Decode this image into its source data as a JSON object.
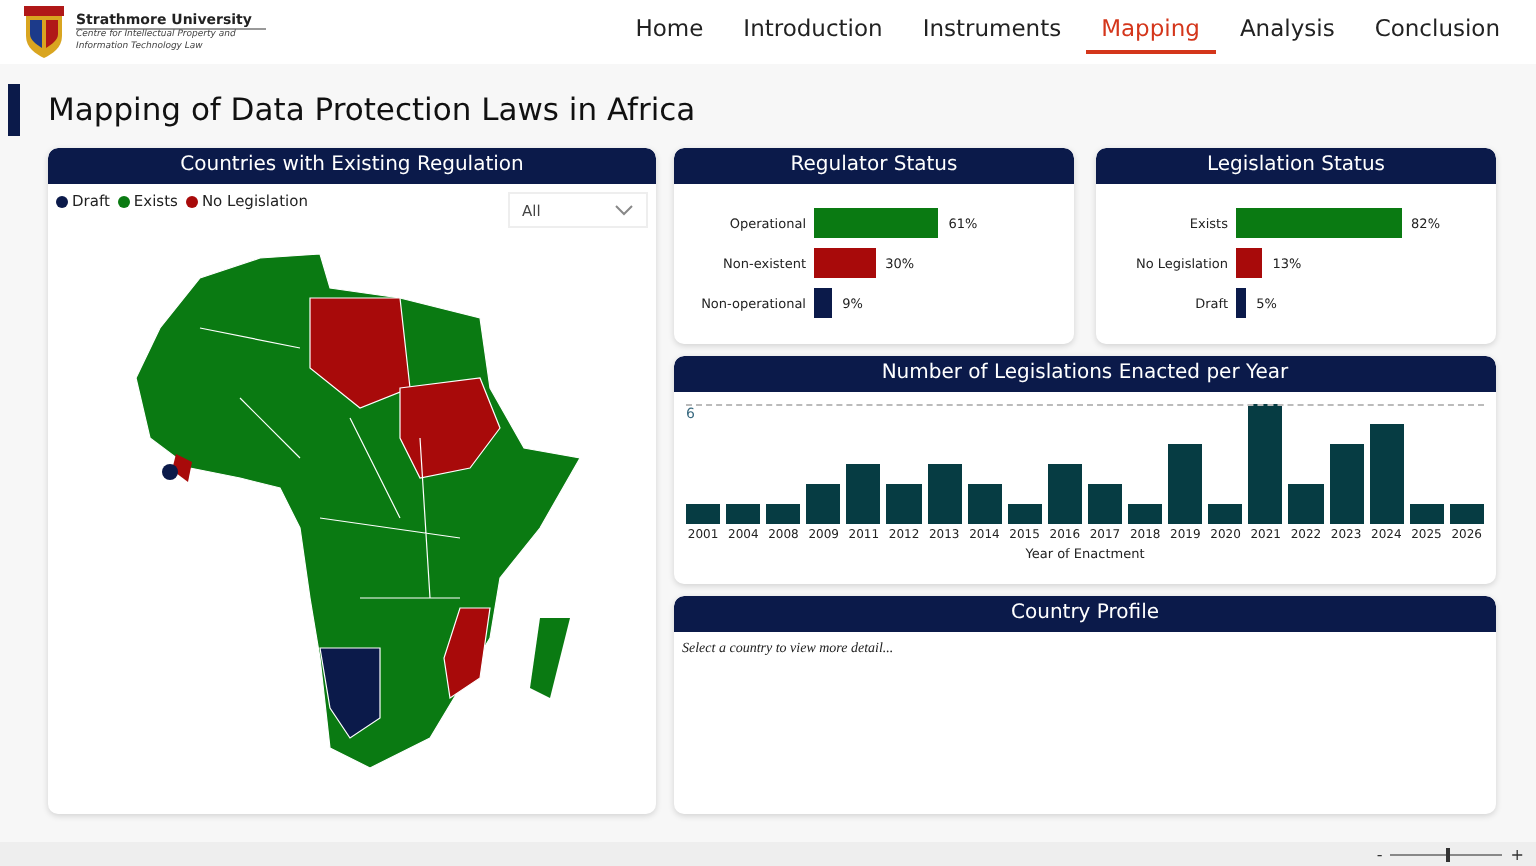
{
  "header": {
    "org_name": "Strathmore University",
    "org_subtitle": "Centre for Intellectual Property and Information Technology Law"
  },
  "nav": [
    {
      "label": "Home",
      "selected": false
    },
    {
      "label": "Introduction",
      "selected": false
    },
    {
      "label": "Instruments",
      "selected": false
    },
    {
      "label": "Mapping",
      "selected": true
    },
    {
      "label": "Analysis",
      "selected": false
    },
    {
      "label": "Conclusion",
      "selected": false
    }
  ],
  "page_title": "Mapping of Data Protection Laws in Africa",
  "map_card": {
    "title": "Countries with Existing Regulation",
    "legend": [
      {
        "label": "Draft",
        "color": "#0b1a4a"
      },
      {
        "label": "Exists",
        "color": "#0a7a12"
      },
      {
        "label": "No Legislation",
        "color": "#a80a0a"
      }
    ],
    "filter": {
      "value": "All"
    }
  },
  "regulator_card": {
    "title": "Regulator Status",
    "chart_data": {
      "type": "bar",
      "orientation": "horizontal",
      "categories": [
        "Operational",
        "Non-existent",
        "Non-operational"
      ],
      "values": [
        61,
        30,
        9
      ],
      "colors": [
        "#0a7a12",
        "#a80a0a",
        "#0b1a4a"
      ],
      "value_labels": [
        "61%",
        "30%",
        "9%"
      ]
    }
  },
  "legislation_card": {
    "title": "Legislation Status",
    "chart_data": {
      "type": "bar",
      "orientation": "horizontal",
      "categories": [
        "Exists",
        "No Legislation",
        "Draft"
      ],
      "values": [
        82,
        13,
        5
      ],
      "colors": [
        "#0a7a12",
        "#a80a0a",
        "#0b1a4a"
      ],
      "value_labels": [
        "82%",
        "13%",
        "5%"
      ]
    }
  },
  "years_card": {
    "title": "Number of Legislations Enacted per Year",
    "chart_data": {
      "type": "bar",
      "xlabel": "Year of Enactment",
      "categories": [
        "2001",
        "2004",
        "2008",
        "2009",
        "2011",
        "2012",
        "2013",
        "2014",
        "2015",
        "2016",
        "2017",
        "2018",
        "2019",
        "2020",
        "2021",
        "2022",
        "2023",
        "2024",
        "2025",
        "2026"
      ],
      "values": [
        1,
        1,
        1,
        2,
        3,
        2,
        3,
        2,
        1,
        3,
        2,
        1,
        4,
        1,
        6,
        2,
        4,
        5,
        1,
        1
      ],
      "ylim": [
        0,
        6
      ],
      "yticks": [
        6
      ]
    }
  },
  "profile_card": {
    "title": "Country Profile",
    "placeholder_text": "Select a country to view more detail..."
  },
  "zoom": {
    "minus": "-",
    "plus": "+",
    "level": 0.5
  }
}
